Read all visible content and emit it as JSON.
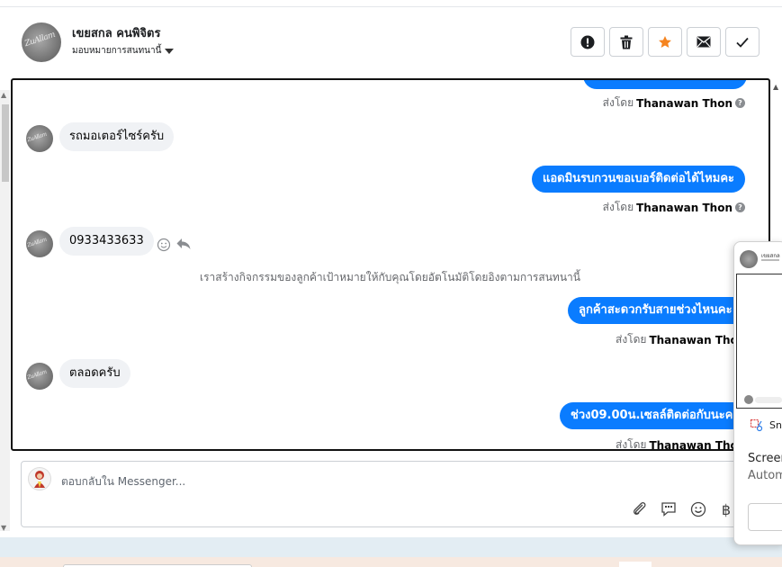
{
  "header": {
    "contact_name": "เขยสกล คนพิจิตร",
    "assign_label": "มอบหมายการสนทนานี้",
    "actions": [
      {
        "name": "mark-spam-button",
        "icon": "exclamation-icon"
      },
      {
        "name": "delete-button",
        "icon": "trash-icon"
      },
      {
        "name": "star-button",
        "icon": "star-icon"
      },
      {
        "name": "mark-unread-button",
        "icon": "envelope-icon"
      },
      {
        "name": "mark-done-button",
        "icon": "check-icon"
      }
    ],
    "star_color": "#f5841f"
  },
  "messages": {
    "sent_by_prefix": "ส่งโดย",
    "sender_name": "Thanawan Thon",
    "in1": "รถมอเตอร์ไซร์ครับ",
    "out1": "แอดมินรบกวนขอเบอร์ติดต่อได้ไหมคะ",
    "in2": "0933433633",
    "system_note": "เราสร้างกิจกรรมของลูกค้าเป้าหมายให้กับคุณโดยอัตโนมัติโดยอิงตามการสนทนานี้",
    "out2": "ลูกค้าสะดวกรับสายช่วงไหนคะ",
    "in3": "ตลอดครับ",
    "out3": "ช่วง09.00น.เซลล์ติดต่อกับนะคะ"
  },
  "composer": {
    "placeholder": "ตอบกลับใน Messenger...",
    "tools": [
      "paperclip-icon",
      "saved-reply-icon",
      "emoji-icon",
      "baht-icon"
    ]
  },
  "popup": {
    "tile_name": "เขยสกล",
    "row_label": "Sn",
    "title": "Screer",
    "subtitle": "Autom"
  },
  "colors": {
    "accent": "#0a7cff",
    "incoming_bubble": "#f0f2f5"
  }
}
